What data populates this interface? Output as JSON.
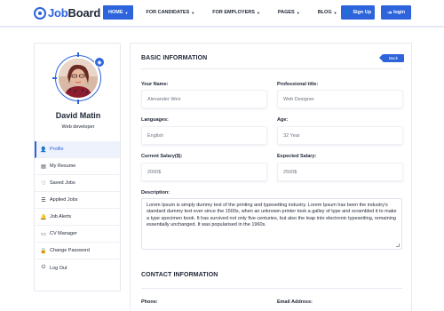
{
  "header": {
    "logo_part1": "Job",
    "logo_part2": "Board",
    "nav": [
      "HOME",
      "FOR CANDIDATES",
      "FOR EMPLOYERS",
      "PAGES",
      "BLOG"
    ],
    "signup_label": "Sign Up",
    "login_label": "login"
  },
  "sidebar": {
    "name": "David Matin",
    "role": "Web developer",
    "menu": [
      {
        "label": "Profile",
        "icon": "person-icon"
      },
      {
        "label": "My Resume",
        "icon": "document-icon"
      },
      {
        "label": "Saved Jobs",
        "icon": "heart-icon"
      },
      {
        "label": "Applied Jobs",
        "icon": "list-icon"
      },
      {
        "label": "Job Alerts",
        "icon": "bell-icon"
      },
      {
        "label": "CV Manager",
        "icon": "folder-icon"
      },
      {
        "label": "Change Password",
        "icon": "lock-icon"
      },
      {
        "label": "Log Out",
        "icon": "logout-icon"
      }
    ]
  },
  "main": {
    "basic_title": "BASIC INFORMATION",
    "back_label": "Back",
    "fields": {
      "name_label": "Your Name:",
      "name_value": "Alexander Weir",
      "title_label": "Professional title:",
      "title_value": "Web Designer",
      "languages_label": "Languages:",
      "languages_value": "English",
      "age_label": "Age:",
      "age_value": "32 Year",
      "current_salary_label": "Current Salary($):",
      "current_salary_value": "2000$",
      "expected_salary_label": "Expected Salary:",
      "expected_salary_value": "2500$",
      "description_label": "Description:",
      "description_value": "Lorem Ipsum is simply dummy text of the printing and typesetting industry. Lorem Ipsum has been the industry's standard dummy text ever since the 1500s, when an unknown printer took a galley of type and scrambled it to make a type specimen book. It has survived not only five centuries, but also the leap into electronic typesetting, remaining essentially unchanged. It was popularised in the 1960s."
    },
    "contact_title": "CONTACT INFORMATION",
    "phone_label": "Phone:",
    "email_label": "Email Address:"
  },
  "colors": {
    "accent": "#2d64dc",
    "text": "#1e2535"
  }
}
